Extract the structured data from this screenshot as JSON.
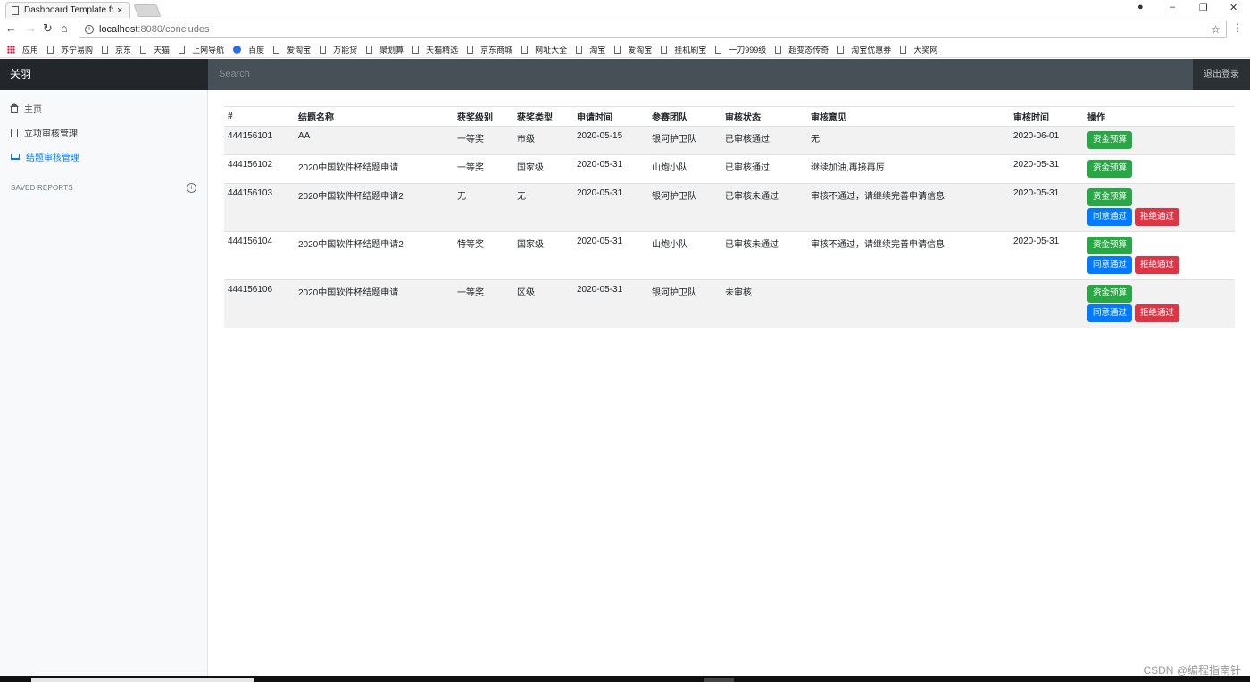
{
  "browser": {
    "tab_title": "Dashboard Template fo",
    "tab_close": "×",
    "window_controls": [
      "–",
      "❐",
      "✕"
    ],
    "url_host": "localhost",
    "url_rest": ":8080/concludes",
    "nav": {
      "back": "←",
      "forward": "→",
      "reload": "↻",
      "home": "⌂"
    },
    "star": "☆",
    "menu": "⋮",
    "bookmarks": [
      {
        "label": "应用",
        "icon": "apps-icon"
      },
      {
        "label": "苏宁易购",
        "icon": "page-icon"
      },
      {
        "label": "京东",
        "icon": "page-icon"
      },
      {
        "label": "天猫",
        "icon": "page-icon"
      },
      {
        "label": "上网导航",
        "icon": "page-icon"
      },
      {
        "label": "百度",
        "icon": "baidu-paw-icon"
      },
      {
        "label": "爱淘宝",
        "icon": "page-icon"
      },
      {
        "label": "万能贷",
        "icon": "page-icon"
      },
      {
        "label": "聚划算",
        "icon": "page-icon"
      },
      {
        "label": "天猫精选",
        "icon": "page-icon"
      },
      {
        "label": "京东商城",
        "icon": "page-icon"
      },
      {
        "label": "网址大全",
        "icon": "page-icon"
      },
      {
        "label": "淘宝",
        "icon": "page-icon"
      },
      {
        "label": "爱淘宝",
        "icon": "page-icon"
      },
      {
        "label": "挂机刷宝",
        "icon": "page-icon"
      },
      {
        "label": "一刀999级",
        "icon": "page-icon"
      },
      {
        "label": "超变态传奇",
        "icon": "page-icon"
      },
      {
        "label": "淘宝优惠券",
        "icon": "page-icon"
      },
      {
        "label": "大奖网",
        "icon": "page-icon"
      }
    ]
  },
  "app": {
    "brand": "关羽",
    "search_placeholder": "Search",
    "logout": "退出登录"
  },
  "sidebar": {
    "items": [
      {
        "label": "主页",
        "icon": "home-icon",
        "active": false
      },
      {
        "label": "立项审核管理",
        "icon": "file-icon",
        "active": false
      },
      {
        "label": "结题审核管理",
        "icon": "cart-icon",
        "active": true
      }
    ],
    "saved_reports": "SAVED REPORTS",
    "saved_add": "⊕"
  },
  "table": {
    "headers": [
      "#",
      "结题名称",
      "获奖级别",
      "获奖类型",
      "申请时间",
      "参赛团队",
      "审核状态",
      "审核意见",
      "审核时间",
      "操作"
    ],
    "rows": [
      {
        "id": "444156101",
        "name": "AA",
        "level": "一等奖",
        "type": "市级",
        "apply_time": "2020-05-15",
        "team": "银河护卫队",
        "status": "已审核通过",
        "opinion": "无",
        "review_time": "2020-06-01",
        "show_review": false
      },
      {
        "id": "444156102",
        "name": "2020中国软件杯结题申请",
        "level": "一等奖",
        "type": "国家级",
        "apply_time": "2020-05-31",
        "team": "山炮小队",
        "status": "已审核通过",
        "opinion": "继续加油,再接再厉",
        "review_time": "2020-05-31",
        "show_review": false
      },
      {
        "id": "444156103",
        "name": "2020中国软件杯结题申请2",
        "level": "无",
        "type": "无",
        "apply_time": "2020-05-31",
        "team": "银河护卫队",
        "status": "已审核未通过",
        "opinion": "审核不通过，请继续完善申请信息",
        "review_time": "2020-05-31",
        "show_review": true
      },
      {
        "id": "444156104",
        "name": "2020中国软件杯结题申请2",
        "level": "特等奖",
        "type": "国家级",
        "apply_time": "2020-05-31",
        "team": "山炮小队",
        "status": "已审核未通过",
        "opinion": "审核不通过，请继续完善申请信息",
        "review_time": "2020-05-31",
        "show_review": true
      },
      {
        "id": "444156106",
        "name": "2020中国软件杯结题申请",
        "level": "一等奖",
        "type": "区级",
        "apply_time": "2020-05-31",
        "team": "银河护卫队",
        "status": "未审核",
        "opinion": "",
        "review_time": "",
        "show_review": true
      }
    ],
    "btn_budget": "资金预算",
    "btn_approve": "同意通过",
    "btn_reject": "拒绝通过"
  },
  "colors": {
    "green": "#28a745",
    "blue": "#007bff",
    "red": "#dc3545",
    "navbar": "#343a40"
  },
  "watermark": "CSDN @编程指南针"
}
